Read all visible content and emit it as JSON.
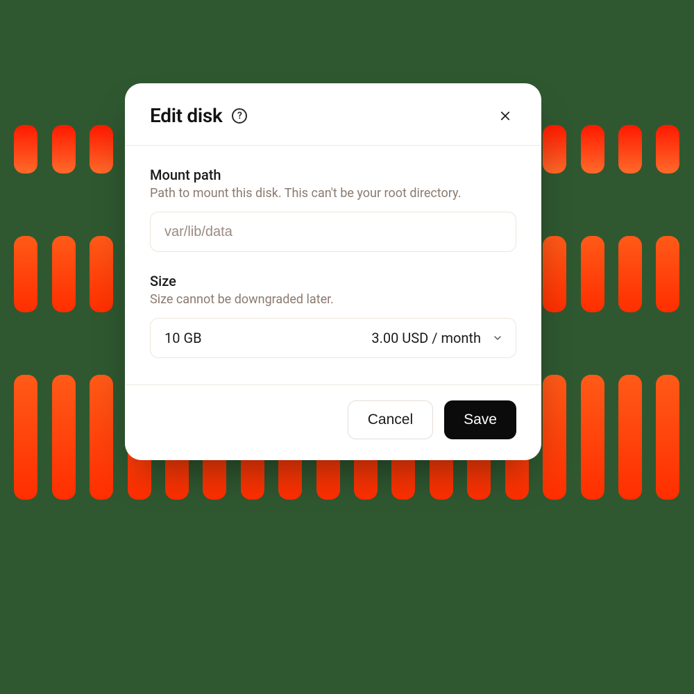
{
  "modal": {
    "title": "Edit disk",
    "help_glyph": "?",
    "fields": {
      "mount": {
        "label": "Mount path",
        "help": "Path to mount this disk. This can't be your root directory.",
        "placeholder": "var/lib/data"
      },
      "size": {
        "label": "Size",
        "help": "Size cannot be downgraded later.",
        "selected_size": "10 GB",
        "selected_price": "3.00 USD / month"
      }
    },
    "actions": {
      "cancel_label": "Cancel",
      "save_label": "Save"
    }
  }
}
